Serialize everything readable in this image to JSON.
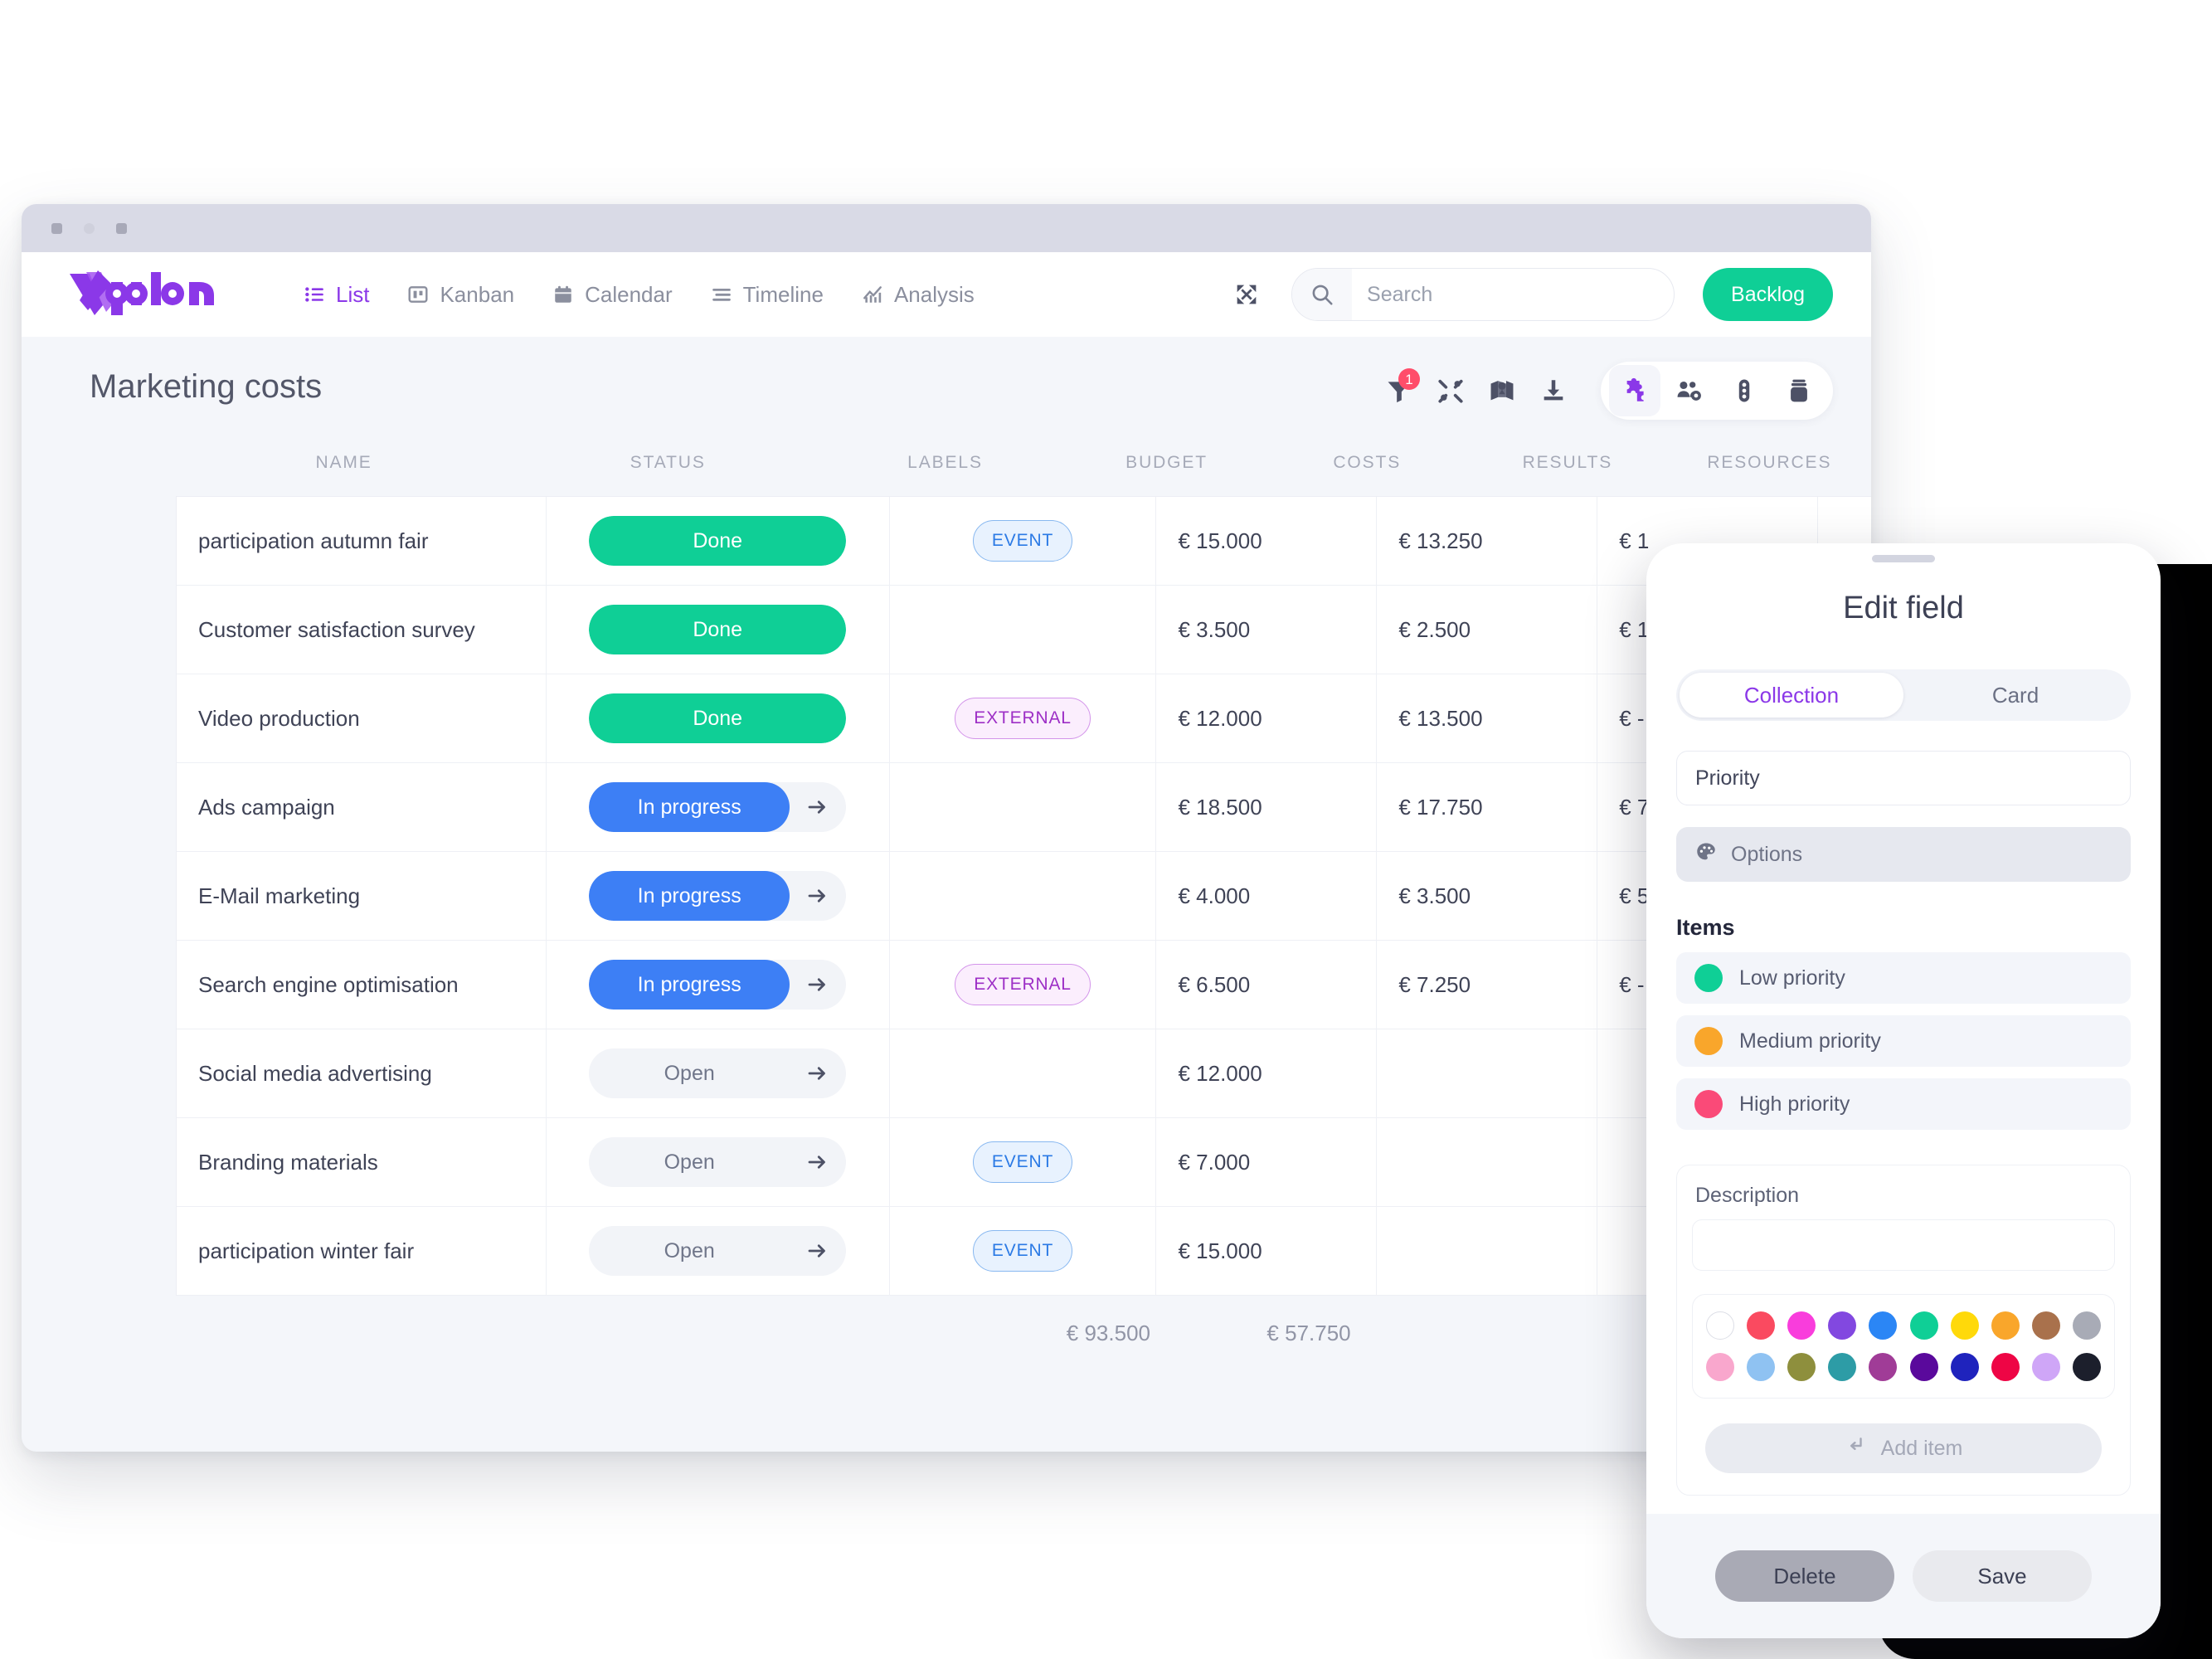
{
  "window": {
    "dots": [
      "",
      "",
      ""
    ]
  },
  "nav": {
    "logo_text": "vplan",
    "tabs": [
      {
        "label": "List",
        "icon": "list-icon",
        "active": true
      },
      {
        "label": "Kanban",
        "icon": "kanban-icon",
        "active": false
      },
      {
        "label": "Calendar",
        "icon": "calendar-icon",
        "active": false
      },
      {
        "label": "Timeline",
        "icon": "timeline-icon",
        "active": false
      },
      {
        "label": "Analysis",
        "icon": "analysis-icon",
        "active": false
      }
    ],
    "expand_icon": "expand-icon",
    "search": {
      "value": "",
      "placeholder": "Search",
      "icon": "search-icon"
    },
    "backlog_label": "Backlog"
  },
  "board": {
    "title": "Marketing costs",
    "tools": [
      {
        "name": "filter-icon",
        "badge": "1"
      },
      {
        "name": "tools-icon",
        "badge": ""
      },
      {
        "name": "map-icon",
        "badge": ""
      },
      {
        "name": "download-icon",
        "badge": ""
      }
    ],
    "pill_tools": [
      {
        "name": "puzzle-icon",
        "selected": true
      },
      {
        "name": "team-settings-icon",
        "selected": false
      },
      {
        "name": "traffic-light-icon",
        "selected": false
      },
      {
        "name": "archive-icon",
        "selected": false
      }
    ]
  },
  "table": {
    "columns": [
      "NAME",
      "STATUS",
      "LABELS",
      "BUDGET",
      "COSTS",
      "RESULTS",
      "RESOURCES"
    ],
    "rows": [
      {
        "name": "participation autumn fair",
        "status": "Done",
        "status_kind": "done",
        "label": "EVENT",
        "label_kind": "event",
        "budget": "€ 15.000",
        "costs": "€ 13.250",
        "results": "€ 1",
        "resources": ""
      },
      {
        "name": "Customer satisfaction survey",
        "status": "Done",
        "status_kind": "done",
        "label": "",
        "label_kind": "",
        "budget": "€ 3.500",
        "costs": "€ 2.500",
        "results": "€ 1",
        "resources": ""
      },
      {
        "name": "Video production",
        "status": "Done",
        "status_kind": "done",
        "label": "EXTERNAL",
        "label_kind": "external",
        "budget": "€ 12.000",
        "costs": "€ 13.500",
        "results": "€ -",
        "resources": ""
      },
      {
        "name": "Ads campaign",
        "status": "In progress",
        "status_kind": "prog",
        "label": "",
        "label_kind": "",
        "budget": "€ 18.500",
        "costs": "€ 17.750",
        "results": "€ 7",
        "resources": ""
      },
      {
        "name": "E-Mail marketing",
        "status": "In progress",
        "status_kind": "prog",
        "label": "",
        "label_kind": "",
        "budget": "€ 4.000",
        "costs": "€ 3.500",
        "results": "€ 5",
        "resources": ""
      },
      {
        "name": "Search engine optimisation",
        "status": "In progress",
        "status_kind": "prog",
        "label": "EXTERNAL",
        "label_kind": "external",
        "budget": "€ 6.500",
        "costs": "€ 7.250",
        "results": "€ -",
        "resources": ""
      },
      {
        "name": "Social media advertising",
        "status": "Open",
        "status_kind": "open",
        "label": "",
        "label_kind": "",
        "budget": "€ 12.000",
        "costs": "",
        "results": "",
        "resources": ""
      },
      {
        "name": "Branding materials",
        "status": "Open",
        "status_kind": "open",
        "label": "EVENT",
        "label_kind": "event",
        "budget": "€ 7.000",
        "costs": "",
        "results": "",
        "resources": ""
      },
      {
        "name": "participation winter fair",
        "status": "Open",
        "status_kind": "open",
        "label": "EVENT",
        "label_kind": "event",
        "budget": "€ 15.000",
        "costs": "",
        "results": "",
        "resources": ""
      }
    ],
    "totals": {
      "budget": "€ 93.500",
      "costs": "€ 57.750"
    }
  },
  "modal": {
    "title": "Edit field",
    "tabs": [
      {
        "label": "Collection",
        "active": true
      },
      {
        "label": "Card",
        "active": false
      }
    ],
    "field_name": "Priority",
    "options_label": "Options",
    "options_icon": "palette-icon",
    "items_heading": "Items",
    "items": [
      {
        "label": "Low priority",
        "color": "#0fcf96"
      },
      {
        "label": "Medium priority",
        "color": "#f9a62b"
      },
      {
        "label": "High priority",
        "color": "#fa4a78"
      }
    ],
    "description_label": "Description",
    "description_value": "",
    "palette_row1": [
      "#ffffff",
      "#fa4a60",
      "#f93ddc",
      "#8248e0",
      "#2b86f5",
      "#0fcf96",
      "#ffd90a",
      "#f9a62b",
      "#a9714c",
      "#a8abb6"
    ],
    "palette_row2": [
      "#f9a7cd",
      "#8fc2f2",
      "#8e8f3d",
      "#2d9ca6",
      "#a03c97",
      "#5a099c",
      "#1f23bd",
      "#ee0545",
      "#cfa6f7",
      "#1c1f2c"
    ],
    "add_item_label": "Add item",
    "add_item_icon": "enter-arrow-icon",
    "delete_label": "Delete",
    "save_label": "Save"
  }
}
